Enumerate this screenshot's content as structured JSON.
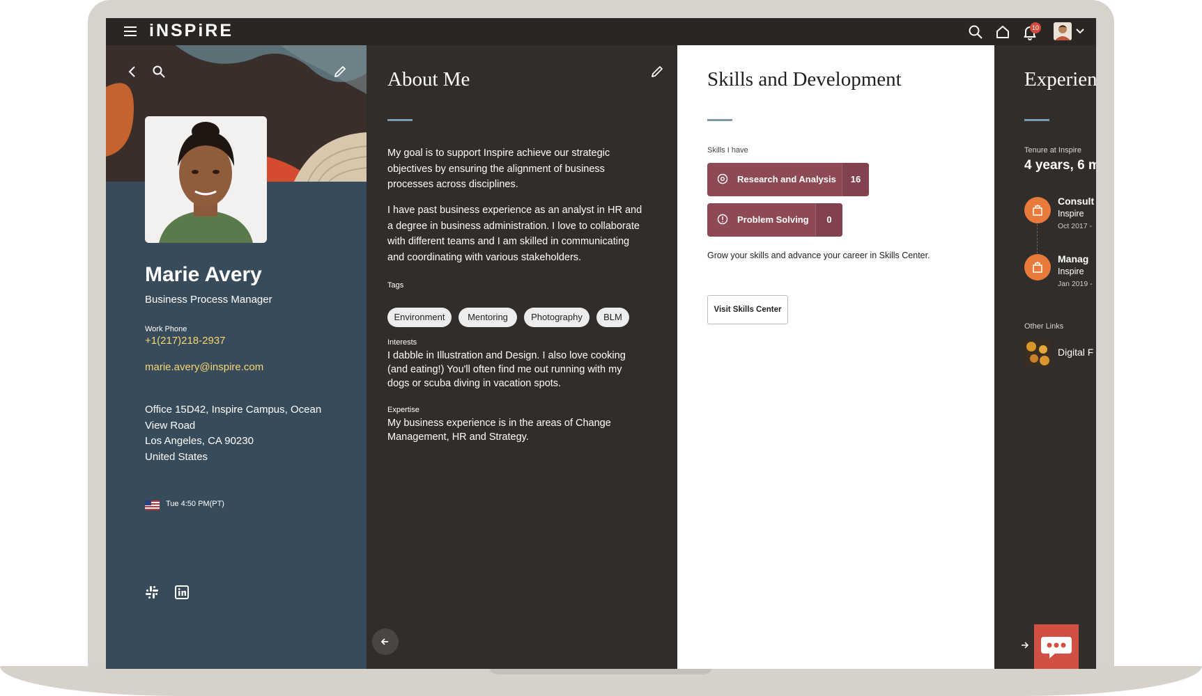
{
  "app": {
    "brand": "iNSPiRE",
    "notifications_count": "10"
  },
  "profile": {
    "name": "Marie Avery",
    "title": "Business Process Manager",
    "work_phone_label": "Work Phone",
    "work_phone": "+1(217)218-2937",
    "email": "marie.avery@inspire.com",
    "address": [
      "Office 15D42, Inspire Campus, Ocean View Road",
      "Los Angeles, CA 90230",
      "United States"
    ],
    "local_time": "Tue 4:50 PM(PT)"
  },
  "about": {
    "title": "About Me",
    "paragraph1": "My goal is to support Inspire achieve our strategic objectives by ensuring the alignment of business processes across disciplines.",
    "paragraph2": "I have past business experience as an analyst in HR and a degree in business administration.  I love to collaborate with different teams and I am skilled in communicating and coordinating with various stakeholders.",
    "tags_label": "Tags",
    "tags": [
      "Environment",
      "Mentoring",
      "Photography",
      "BLM"
    ],
    "interests_label": "Interests",
    "interests": "I dabble in Illustration and Design. I also love cooking (and eating!) You'll often find me out running with my dogs or scuba diving in vacation spots.",
    "expertise_label": "Expertise",
    "expertise": "My business experience is in the areas of Change Management, HR and Strategy."
  },
  "skills": {
    "title": "Skills and Development",
    "have_label": "Skills I have",
    "items": [
      {
        "label": "Research and Analysis",
        "count": "16"
      },
      {
        "label": "Problem Solving",
        "count": "0"
      }
    ],
    "grow_text": "Grow your skills and advance your career in Skills Center.",
    "visit_button": "Visit Skills Center"
  },
  "experience": {
    "title": "Experien",
    "tenure_label": "Tenure at Inspire",
    "tenure": "4 years, 6 m",
    "jobs": [
      {
        "title": "Consult",
        "company": "Inspire",
        "date": "Oct 2017 -"
      },
      {
        "title": "Manag",
        "company": "Inspire",
        "date": "Jan 2019 -"
      }
    ],
    "other_links_label": "Other Links",
    "link_label": "Digital F"
  },
  "colors": {
    "profile_bg": "#384b5a",
    "dark_bg": "#312d2a",
    "skill_pill": "#8d4a55",
    "accent_yellow": "#f7d675",
    "chat_fab": "#d15043"
  }
}
